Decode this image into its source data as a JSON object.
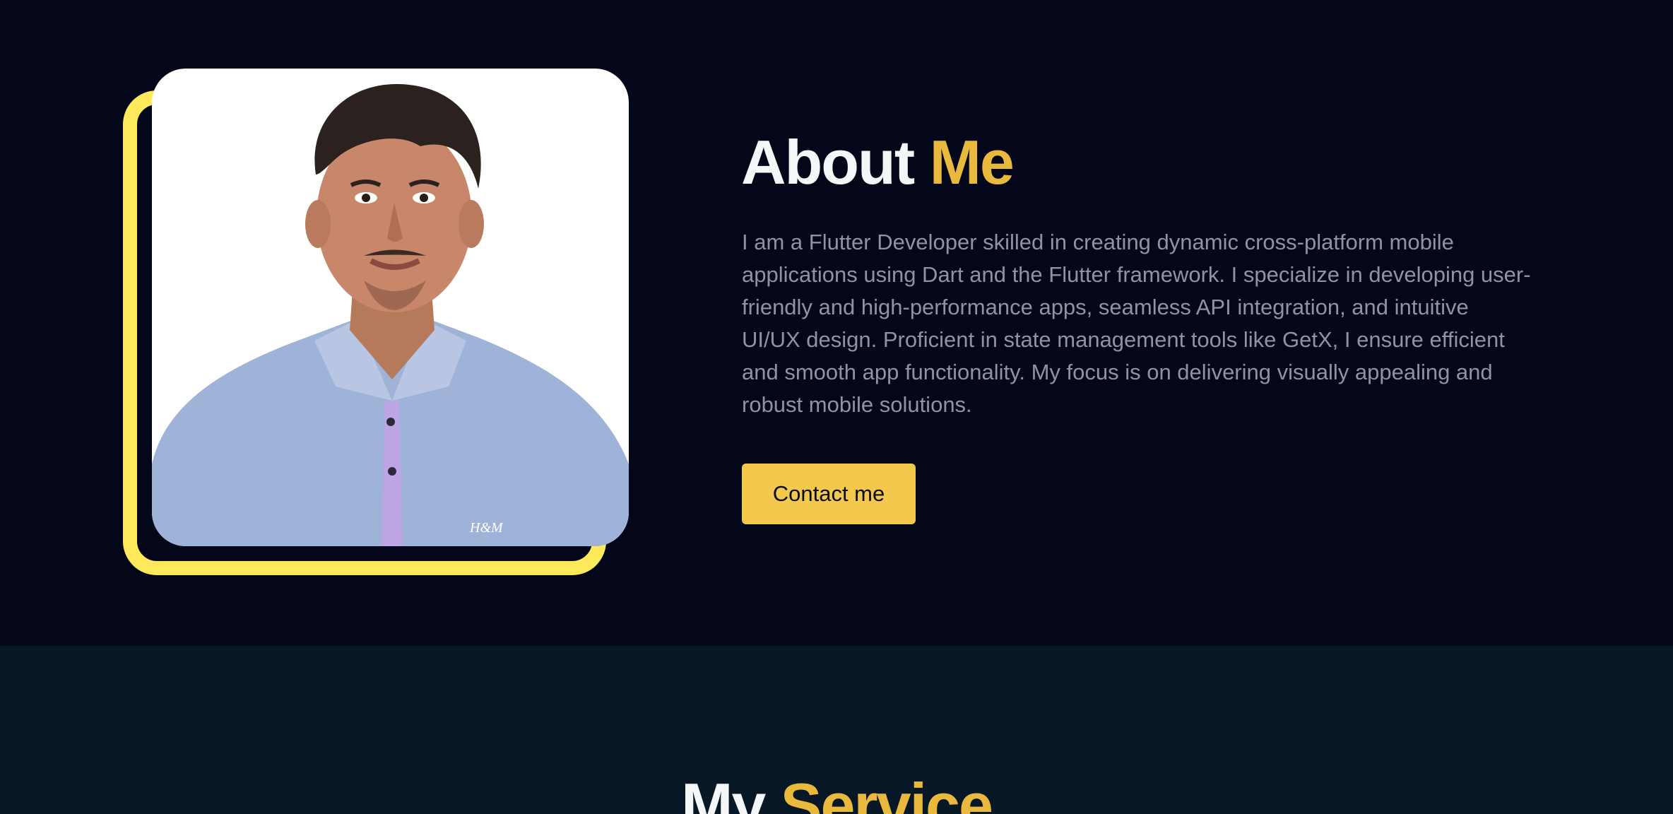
{
  "about": {
    "title_part1": "About",
    "title_part2": "Me",
    "description": "I am a Flutter Developer skilled in creating dynamic cross-platform mobile applications using Dart and the Flutter framework. I specialize in developing user-friendly and high-performance apps, seamless API integration, and intuitive UI/UX design. Proficient in state management tools like GetX, I ensure efficient and smooth app functionality. My focus is on delivering visually appealing and robust mobile solutions.",
    "contact_button": "Contact me",
    "photo_alt": "Portrait photo"
  },
  "service": {
    "title_part1": "My",
    "title_part2": "Service"
  },
  "colors": {
    "background": "#04071a",
    "service_background": "#071726",
    "accent": "#e8b93d",
    "frame": "#fde95a",
    "button": "#f2c94c",
    "body_text": "#8f93a3"
  }
}
